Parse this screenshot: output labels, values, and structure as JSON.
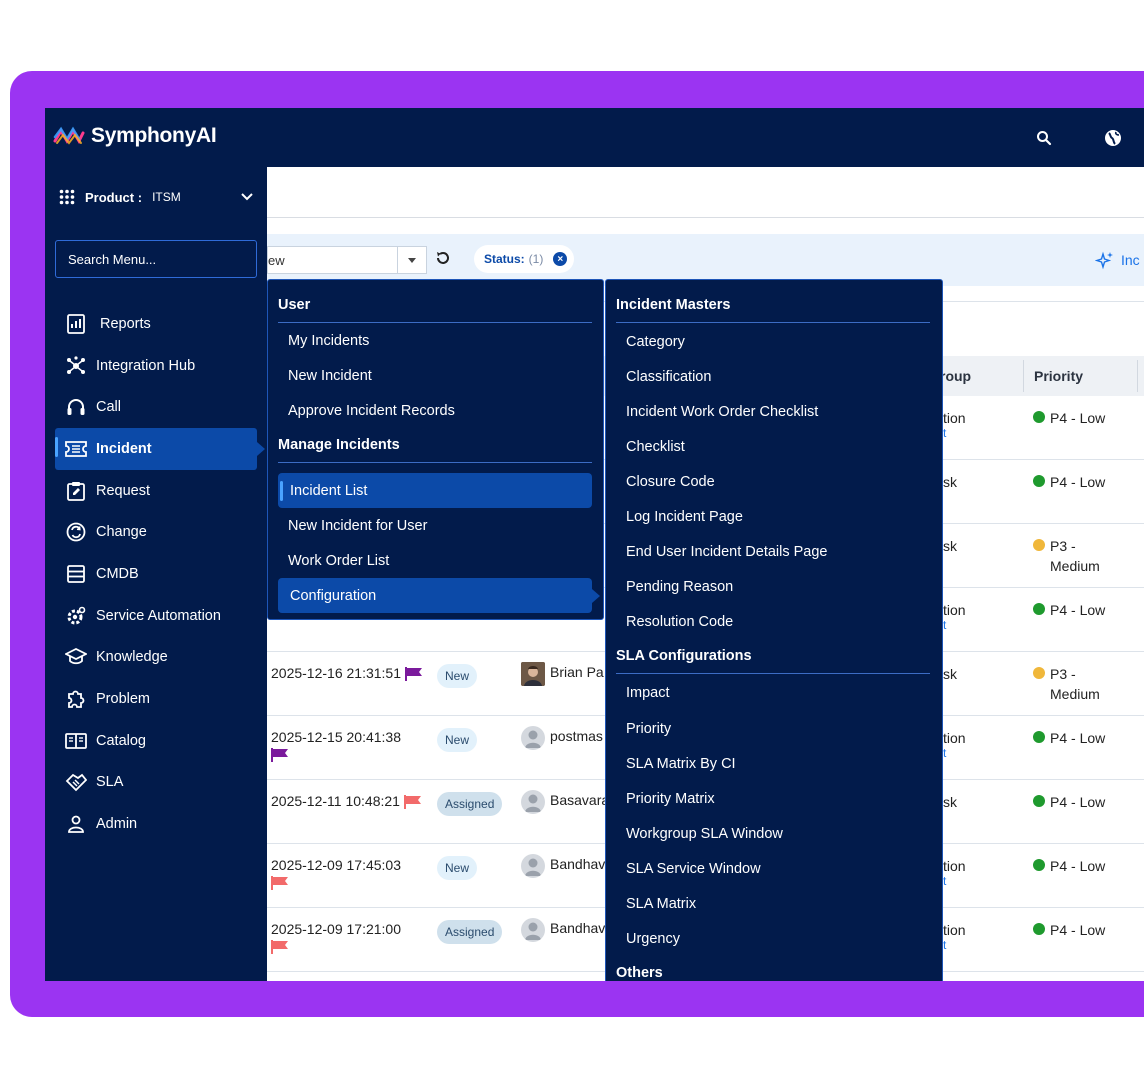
{
  "brand": {
    "name": "SymphonyAI"
  },
  "product": {
    "label": "Product :",
    "value": "ITSM"
  },
  "search_menu": {
    "placeholder": "Search Menu..."
  },
  "nav": [
    {
      "label": "Reports",
      "icon": "reports-icon"
    },
    {
      "label": "Integration Hub",
      "icon": "hub-icon"
    },
    {
      "label": "Call",
      "icon": "headset-icon"
    },
    {
      "label": "Incident",
      "icon": "ticket-icon",
      "active": true
    },
    {
      "label": "Request",
      "icon": "clipboard-edit-icon"
    },
    {
      "label": "Change",
      "icon": "change-icon"
    },
    {
      "label": "CMDB",
      "icon": "database-icon"
    },
    {
      "label": "Service Automation",
      "icon": "automation-gear-icon"
    },
    {
      "label": "Knowledge",
      "icon": "graduation-cap-icon"
    },
    {
      "label": "Problem",
      "icon": "puzzle-icon"
    },
    {
      "label": "Catalog",
      "icon": "book-icon"
    },
    {
      "label": "SLA",
      "icon": "handshake-icon"
    },
    {
      "label": "Admin",
      "icon": "user-icon"
    }
  ],
  "filter": {
    "view_value": "ew",
    "status_label": "Status:",
    "status_count": "(1)",
    "ai_label": "Inc"
  },
  "table": {
    "headers": {
      "group": "roup",
      "priority": "Priority"
    },
    "top_rows": [
      {
        "group": "tion",
        "group_sub": "t",
        "priority": "P4 - Low",
        "dot": "#1f9a2e"
      },
      {
        "group": "sk",
        "group_sub": "",
        "priority": "P4 - Low",
        "dot": "#1f9a2e"
      },
      {
        "group": "sk",
        "group_sub": "",
        "priority": "P3 - Medium",
        "dot": "#f0b73a"
      },
      {
        "group": "tion",
        "group_sub": "t",
        "priority": "P4 - Low",
        "dot": "#1f9a2e"
      }
    ],
    "rows": [
      {
        "date": "2025-12-16 21:31:51",
        "flag": "#7b1a9c",
        "flag_newline": false,
        "status": "New",
        "status_type": "new",
        "avatar": "photo",
        "user": "Brian Pa",
        "group": "sk",
        "group_sub": "",
        "priority": "P3 - Medium",
        "dot": "#f0b73a"
      },
      {
        "date": "2025-12-15 20:41:38",
        "flag": "#7b1a9c",
        "flag_newline": true,
        "status": "New",
        "status_type": "new",
        "avatar": "default",
        "user": "postmas",
        "group": "tion",
        "group_sub": "t",
        "priority": "P4 - Low",
        "dot": "#1f9a2e"
      },
      {
        "date": "2025-12-11 10:48:21",
        "flag": "#f26a6a",
        "flag_newline": false,
        "status": "Assigned",
        "status_type": "assigned",
        "avatar": "default",
        "user": "Basavara",
        "group": "sk",
        "group_sub": "",
        "priority": "P4 - Low",
        "dot": "#1f9a2e"
      },
      {
        "date": "2025-12-09 17:45:03",
        "flag": "#f26a6a",
        "flag_newline": true,
        "status": "New",
        "status_type": "new",
        "avatar": "default",
        "user": "Bandhav",
        "group": "tion",
        "group_sub": "t",
        "priority": "P4 - Low",
        "dot": "#1f9a2e"
      },
      {
        "date": "2025-12-09 17:21:00",
        "flag": "#f26a6a",
        "flag_newline": true,
        "status": "Assigned",
        "status_type": "assigned",
        "avatar": "default",
        "user": "Bandhav",
        "group": "tion",
        "group_sub": "t",
        "priority": "P4 - Low",
        "dot": "#1f9a2e"
      }
    ]
  },
  "menu1": {
    "user_heading": "User",
    "user_items": [
      "My Incidents",
      "New Incident",
      "Approve Incident Records"
    ],
    "manage_heading": "Manage Incidents",
    "manage_items": [
      "Incident List",
      "New Incident for User",
      "Work Order List",
      "Configuration"
    ]
  },
  "menu2": {
    "masters_heading": "Incident Masters",
    "masters_items": [
      "Category",
      "Classification",
      "Incident Work Order Checklist",
      "Checklist",
      "Closure Code",
      "Log Incident Page",
      "End User Incident Details Page",
      "Pending Reason",
      "Resolution Code"
    ],
    "sla_heading": "SLA Configurations",
    "sla_items": [
      "Impact",
      "Priority",
      "SLA Matrix By CI",
      "Priority Matrix",
      "Workgroup SLA Window",
      "SLA Service Window",
      "SLA Matrix",
      "Urgency"
    ],
    "others_heading": "Others"
  },
  "colors": {
    "navy": "#021b4b",
    "accent": "#0c4aa8",
    "frame": "#9b34f2"
  }
}
